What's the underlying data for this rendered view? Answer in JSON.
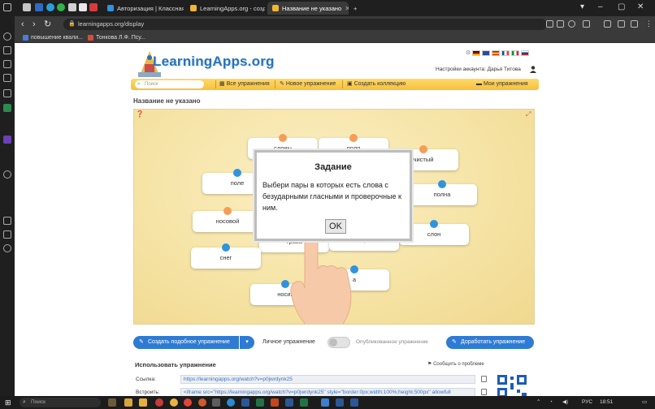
{
  "browser": {
    "tabs": [
      {
        "label": "Авторизация | Классная ..."
      },
      {
        "label": "LearningApps.org - созд..."
      },
      {
        "label": "Название не указано"
      }
    ],
    "new_tab": "+",
    "url": "learningapps.org/display",
    "bookmarks": [
      {
        "label": "повышение квали..."
      },
      {
        "label": "Тонкова Л.Ф. Псу..."
      }
    ]
  },
  "site": {
    "logo_text": "LearningApps.org",
    "account_text": "Настройки аккаунта: Дарья Титова",
    "menu": {
      "search_placeholder": "Поиск",
      "all_exercises": "Все упражнения",
      "new_exercise": "Новое упражнение",
      "create_collection": "Создать коллекцию",
      "my_exercises": "Мои упражнения"
    },
    "page_title": "Название не указано"
  },
  "game": {
    "cards": [
      {
        "text": "слоны",
        "dot": "orange"
      },
      {
        "text": "поля",
        "dot": "orange"
      },
      {
        "text": "чистый",
        "dot": "orange"
      },
      {
        "text": "поле",
        "dot": "blue"
      },
      {
        "text": "носовой",
        "dot": "orange"
      },
      {
        "text": "полна",
        "dot": "blue"
      },
      {
        "text": "слон",
        "dot": "blue"
      },
      {
        "text": "трава",
        "dot": "blue"
      },
      {
        "text": "нора",
        "dot": "blue"
      },
      {
        "text": "снег",
        "dot": "blue"
      },
      {
        "text": "а",
        "dot": "blue"
      },
      {
        "text": "носик",
        "dot": "blue"
      }
    ],
    "dialog": {
      "title": "Задание",
      "text": "Выбери пары в которых есть слова с безударными гласными и проверочные к ним.",
      "ok": "OK"
    }
  },
  "actions": {
    "create_similar": "Создать подобное упражнение",
    "private_label": "Личное упражнение",
    "public_label": "Опубликованное упражнение",
    "improve": "Доработать упражнение"
  },
  "usage": {
    "title": "Использовать упражнение",
    "report": "Сообщить о проблеме",
    "link_label": "Ссылка:",
    "link_value": "https://learningapps.org/watch?v=p0jwrdynk25",
    "embed_label": "Встроить:",
    "embed_value": "<iframe src=\"https://learningapps.org/watch?v=p0jwrdynk25\" style=\"border:0px;width:100%;height:500px\" allowfull"
  },
  "taskbar": {
    "search_placeholder": "Поиск",
    "lang": "РУС",
    "time": "18:51"
  },
  "colors": {
    "accent_blue": "#2e7bd4",
    "menu_yellow": "#f6c03a",
    "dot_orange": "#f59d57",
    "dot_blue": "#2f94dd"
  }
}
